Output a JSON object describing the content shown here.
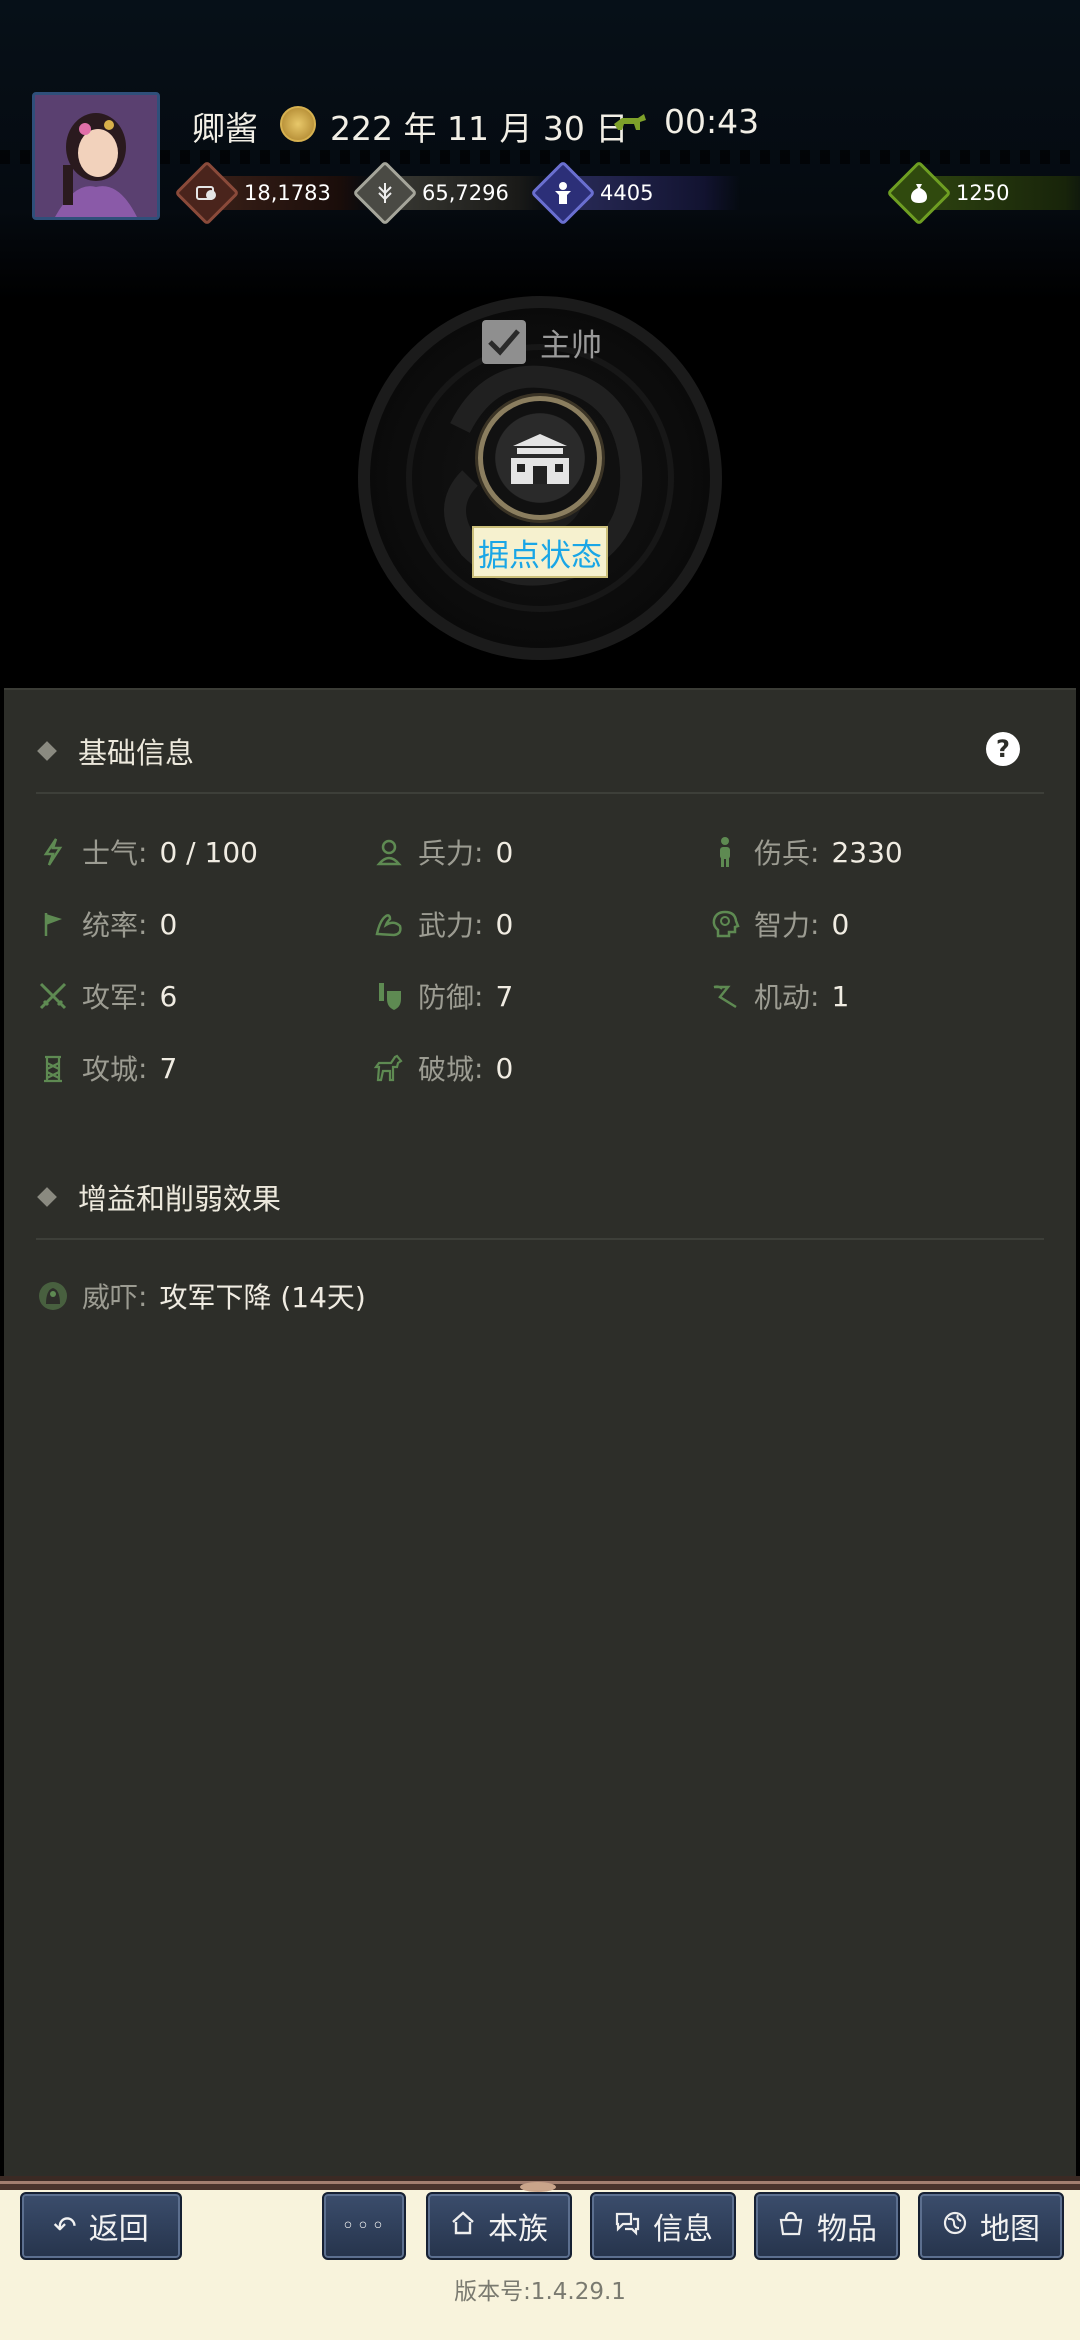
{
  "header": {
    "player_name": "卿酱",
    "date": "222 年 11 月 30 日",
    "time": "00:43",
    "resources": [
      {
        "icon": "coin-icon",
        "value": "18,1783",
        "color": "#8a4a3a"
      },
      {
        "icon": "grain-icon",
        "value": "65,7296",
        "color": "#a5a59a"
      },
      {
        "icon": "soldier-icon",
        "value": "4405",
        "color": "#4b4fa0"
      },
      {
        "icon": "money-bag-icon",
        "value": "1250",
        "color": "#5c8a1e"
      }
    ]
  },
  "seal": {
    "commander_label": "主帅",
    "commander_checked": true,
    "fort_status_label": "据点状态"
  },
  "basic_info": {
    "title": "基础信息",
    "help_label": "?",
    "stats": [
      {
        "icon": "morale-icon",
        "label": "士气",
        "value": "0 / 100"
      },
      {
        "icon": "troops-icon",
        "label": "兵力",
        "value": "0"
      },
      {
        "icon": "wounded-icon",
        "label": "伤兵",
        "value": "2330"
      },
      {
        "icon": "command-flag-icon",
        "label": "统率",
        "value": "0"
      },
      {
        "icon": "strength-arm-icon",
        "label": "武力",
        "value": "0"
      },
      {
        "icon": "intellect-head-icon",
        "label": "智力",
        "value": "0"
      },
      {
        "icon": "crossed-swords-icon",
        "label": "攻军",
        "value": "6"
      },
      {
        "icon": "shield-icon",
        "label": "防御",
        "value": "7"
      },
      {
        "icon": "mobility-icon",
        "label": "机动",
        "value": "1"
      },
      {
        "icon": "siege-tower-icon",
        "label": "攻城",
        "value": "7"
      },
      {
        "icon": "horse-icon",
        "label": "破城",
        "value": "0"
      }
    ]
  },
  "effects": {
    "title": "增益和削弱效果",
    "items": [
      {
        "icon": "intimidate-icon",
        "label": "威吓",
        "value": "攻军下降 (14天)"
      }
    ]
  },
  "footer": {
    "back_label": "返回",
    "more_label": "◦◦◦",
    "clan_label": "本族",
    "info_label": "信息",
    "items_label": "物品",
    "map_label": "地图",
    "version": "版本号:1.4.29.1"
  }
}
